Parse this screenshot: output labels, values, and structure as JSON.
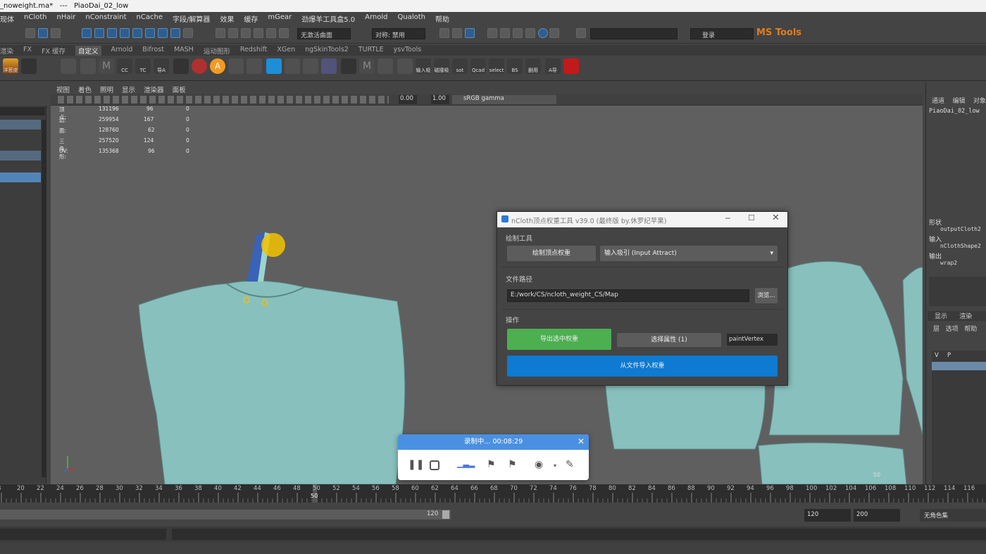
{
  "window": {
    "title": "_noweight.ma*   ---   PiaoDai_02_low"
  },
  "menu": [
    "现体",
    "nCloth",
    "nHair",
    "nConstraint",
    "nCache",
    "字段/解算器",
    "效果",
    "缓存",
    "mGear",
    "劲爆羊工具盒5.0",
    "Arnold",
    "Qualoth",
    "帮助"
  ],
  "status": {
    "live_surface": "无激活曲面",
    "symmetry": "对称: 禁用",
    "login": "登录",
    "brand": "MS Tools"
  },
  "shelf_tabs": [
    "渲染",
    "FX",
    "FX 缓存",
    "自定义",
    "Arnold",
    "Bifrost",
    "MASH",
    "运动图形",
    "Redshift",
    "XGen",
    "ngSkinTools2",
    "TURTLE",
    "ysvTools"
  ],
  "shelf_active": "自定义",
  "shelf_labels": [
    "洋葱皮",
    "CC",
    "TC",
    "导A",
    "输入吸引",
    "磁撞吸引",
    "sot",
    "Qcad",
    "select",
    "BS",
    "删用",
    "A导"
  ],
  "viewport_menu": [
    "视图",
    "着色",
    "照明",
    "显示",
    "渲染器",
    "面板"
  ],
  "viewport_tools": {
    "exposure": "0.00",
    "gamma": "1.00",
    "colorspace": "sRGB gamma"
  },
  "hud": [
    {
      "label": "顶点:",
      "a": "131196",
      "b": "96",
      "c": "0"
    },
    {
      "label": "边:",
      "a": "259954",
      "b": "167",
      "c": "0"
    },
    {
      "label": "面:",
      "a": "128760",
      "b": "62",
      "c": "0"
    },
    {
      "label": "三角形:",
      "a": "257520",
      "b": "124",
      "c": "0"
    },
    {
      "label": "UV:",
      "a": "135368",
      "b": "96",
      "c": "0"
    }
  ],
  "channel_box": {
    "tabs": [
      "通道",
      "编辑",
      "对象"
    ],
    "object": "PiaoDai_02_low",
    "shape_header": "形状",
    "shape": "outputCloth2",
    "inputs_header": "输入",
    "input": "nClothShape2",
    "outputs_header": "输出",
    "output": "wrap2"
  },
  "layer_editor": {
    "tabs": [
      "显示",
      "渲染"
    ],
    "menu": [
      "层",
      "选项",
      "帮助"
    ],
    "cols": [
      "V",
      "P"
    ]
  },
  "dialog": {
    "title": "nCloth顶点权重工具 v39.0 (最终版 by.休罗纪苹果)",
    "section_paint": "绘制工具",
    "paint_button": "绘制顶点权重",
    "attr_dropdown": "输入吸引 (Input Attract)",
    "section_path": "文件路径",
    "path_value": "E:/work/CS/ncloth_weight_CS/Map",
    "browse_button": "浏览...",
    "section_ops": "操作",
    "export_button": "导出选中权重",
    "select_attr_button": "选择属性 (1)",
    "attr_field": "paintVertex",
    "import_button": "从文件导入权重",
    "colors": {
      "export": "#4caf50",
      "import": "#0e7ad1"
    }
  },
  "recorder": {
    "status": "录制中... 00:08:29"
  },
  "timeline": {
    "ticks": [
      "8",
      "20",
      "22",
      "24",
      "26",
      "28",
      "30",
      "32",
      "34",
      "36",
      "38",
      "40",
      "42",
      "44",
      "46",
      "48",
      "50",
      "52",
      "54",
      "56",
      "58",
      "60",
      "62",
      "64",
      "66",
      "68",
      "70",
      "72",
      "74",
      "76",
      "78",
      "80",
      "82",
      "84",
      "86",
      "88",
      "90",
      "92",
      "94",
      "96",
      "98",
      "100",
      "102",
      "104",
      "106",
      "108",
      "110",
      "112",
      "114",
      "116"
    ],
    "current": "50"
  },
  "range": {
    "slider_end": "120",
    "end": "120",
    "anim_end": "200",
    "char_set": "无角色集"
  },
  "viewport_corner": {
    "value": "50"
  }
}
